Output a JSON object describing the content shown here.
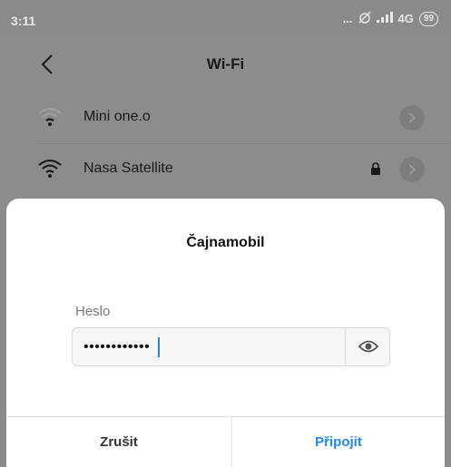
{
  "status_bar": {
    "time": "3:11",
    "dots": "...",
    "network": "4G",
    "battery": "99"
  },
  "header": {
    "title": "Wi-Fi"
  },
  "networks": [
    {
      "name": "Mini one.o",
      "locked": false
    },
    {
      "name": "Nasa Satellite",
      "locked": true
    }
  ],
  "dialog": {
    "title": "Čajnamobil",
    "password_label": "Heslo",
    "password_value": "••••••••••••",
    "cancel_label": "Zrušit",
    "connect_label": "Připojit"
  },
  "colors": {
    "accent": "#1e88e5",
    "dimmed_background": "#8c8c8c",
    "dialog_background": "#ffffff"
  }
}
